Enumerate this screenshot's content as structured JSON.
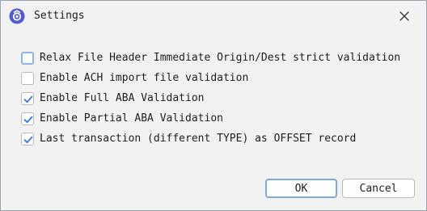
{
  "window": {
    "title": "Settings",
    "app_icon": "app-logo-icon",
    "close_icon": "close-icon"
  },
  "options": [
    {
      "label": "Relax File Header Immediate Origin/Dest strict validation",
      "checked": false,
      "focused": true
    },
    {
      "label": "Enable ACH import file validation",
      "checked": false,
      "focused": false
    },
    {
      "label": "Enable Full ABA Validation",
      "checked": true,
      "focused": false
    },
    {
      "label": "Enable Partial ABA Validation",
      "checked": true,
      "focused": false
    },
    {
      "label": "Last transaction (different TYPE) as OFFSET record",
      "checked": true,
      "focused": false
    }
  ],
  "buttons": {
    "ok_label": "OK",
    "cancel_label": "Cancel"
  },
  "colors": {
    "accent": "#2f6bd6",
    "check": "#3574f0",
    "focus_ring": "#8db5e6"
  }
}
